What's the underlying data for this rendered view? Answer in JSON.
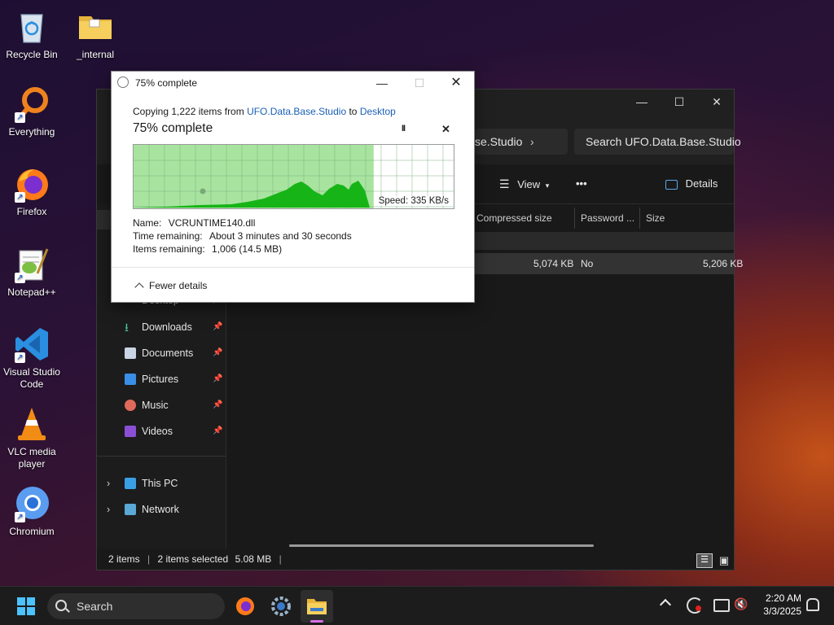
{
  "desktop": {
    "icons": [
      {
        "label": "Recycle Bin"
      },
      {
        "label": "_internal"
      },
      {
        "label": "Everything"
      },
      {
        "label": "Firefox"
      },
      {
        "label": "Notepad++"
      },
      {
        "label": "Visual Studio Code"
      },
      {
        "label": "VLC media player"
      },
      {
        "label": "Chromium"
      }
    ]
  },
  "explorer": {
    "breadcrumb_tail": "se.Studio",
    "search_placeholder": "Search UFO.Data.Base.Studio",
    "toolbar": {
      "view_label": "View",
      "more_label": "•••",
      "details_label": "Details"
    },
    "columns": [
      "Compressed size",
      "Password ...",
      "Size"
    ],
    "row": {
      "compressed": "5,074 KB",
      "password": "No",
      "size": "5,206 KB"
    },
    "nav": {
      "desktop": "Desktop",
      "downloads": "Downloads",
      "documents": "Documents",
      "pictures": "Pictures",
      "music": "Music",
      "videos": "Videos",
      "this_pc": "This PC",
      "network": "Network"
    },
    "status": {
      "items": "2 items",
      "selected": "2 items selected",
      "size": "5.08 MB"
    }
  },
  "dialog": {
    "title": "75% complete",
    "copying_prefix": "Copying 1,222 items from ",
    "source": "UFO.Data.Base.Studio",
    "to_word": " to ",
    "dest": "Desktop",
    "heading": "75% complete",
    "progress": 0.75,
    "speed": "Speed: 335 KB/s",
    "name_label": "Name:",
    "name_value": "VCRUNTIME140.dll",
    "time_label": "Time remaining:",
    "time_value": "About 3 minutes and 30 seconds",
    "items_label": "Items remaining:",
    "items_value": "1,006 (14.5 MB)",
    "fewer_details": "Fewer details",
    "pause_glyph": "II",
    "close_glyph": "✕"
  },
  "taskbar": {
    "search_label": "Search",
    "time": "2:20 AM",
    "date": "3/3/2025"
  },
  "colors": {
    "link": "#1a5fb4",
    "graph_fill": "#a8e4a0",
    "graph_line": "#17b417",
    "accent": "#0078d4"
  }
}
